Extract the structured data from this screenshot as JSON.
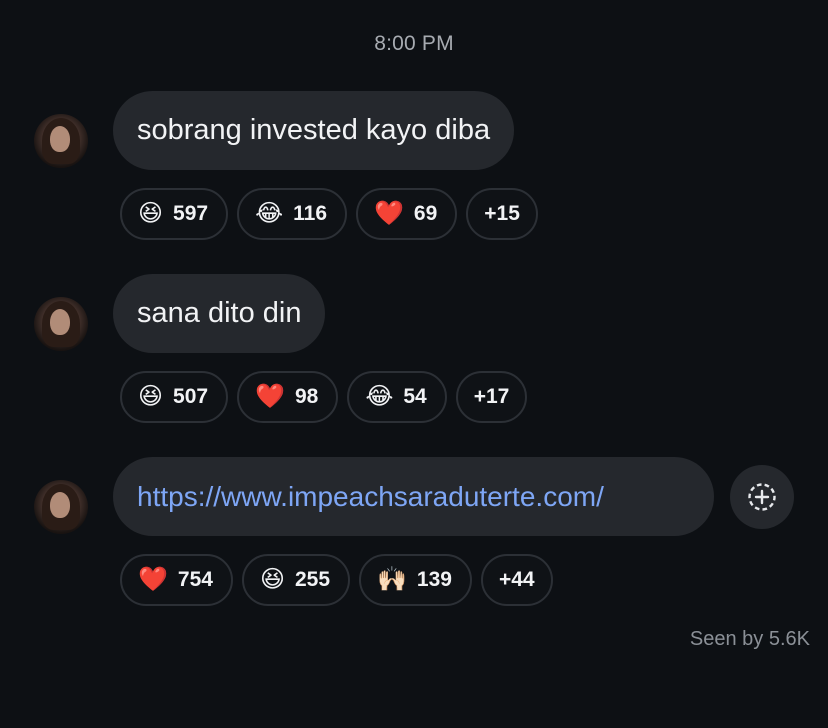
{
  "timestamp": "8:00 PM",
  "messages": [
    {
      "text": "sobrang invested kayo diba",
      "reactions": [
        {
          "emoji": "😆",
          "count": "597"
        },
        {
          "emoji": "😂",
          "count": "116"
        },
        {
          "emoji": "❤️",
          "count": "69"
        }
      ],
      "more": "+15"
    },
    {
      "text": "sana dito din",
      "reactions": [
        {
          "emoji": "😆",
          "count": "507"
        },
        {
          "emoji": "❤️",
          "count": "98"
        },
        {
          "emoji": "😂",
          "count": "54"
        }
      ],
      "more": "+17"
    },
    {
      "text": "https://www.impeachsaraduterte.com/",
      "reactions": [
        {
          "emoji": "❤️",
          "count": "754"
        },
        {
          "emoji": "😆",
          "count": "255"
        },
        {
          "emoji": "🙌🏻",
          "count": "139"
        }
      ],
      "more": "+44"
    }
  ],
  "seen": "Seen by 5.6K",
  "icons": {
    "add_reaction": "add-reaction-icon"
  },
  "colors": {
    "background": "#0d1014",
    "bubble": "#25282d",
    "link": "#7ea6f5",
    "muted_text": "#a7abb1"
  }
}
